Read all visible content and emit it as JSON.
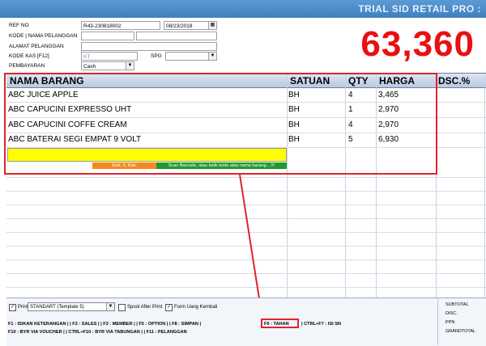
{
  "window": {
    "title": "TRIAL SID RETAIL PRO :"
  },
  "form": {
    "ref_no_label": "REF NO",
    "ref_no_value": "R43-230818002",
    "date_value": "08/23/2018",
    "kode_pelanggan_label": "KODE | NAMA PELANGGAN",
    "alamat_label": "ALAMAT PELANGGAN",
    "kode_kas_label": "KODE KAS [F12]",
    "kode_kas_value": "KT",
    "spg_label": "SPG",
    "pembayaran_label": "PEMBAYARAN",
    "pembayaran_value": "Cash"
  },
  "total_display": "63,360",
  "grid": {
    "headers": [
      "NAMA BARANG",
      "SATUAN",
      "QTY",
      "HARGA",
      "DSC.%"
    ],
    "rows": [
      {
        "nama": "ABC JUICE APPLE",
        "satuan": "BH",
        "qty": "4",
        "harga": "3,465"
      },
      {
        "nama": "ABC CAPUCINI EXPRESSO UHT",
        "satuan": "BH",
        "qty": "1",
        "harga": "2,970"
      },
      {
        "nama": "ABC CAPUCINI COFFE CREAM",
        "satuan": "BH",
        "qty": "4",
        "harga": "2,970"
      },
      {
        "nama": "ABC BATERAI SEGI EMPAT 9 VOLT",
        "satuan": "BH",
        "qty": "5",
        "harga": "6,930"
      }
    ],
    "stok_text": "Stok: 0, Rak:",
    "scan_text": "Scan Barcode, atau ketik kode atau nama barang....!!!"
  },
  "bottom": {
    "print_label": "Print",
    "template_value": "STANDART (Template 5)",
    "spool_label": "Spool After Print",
    "form_uang_label": "Form Uang Kembali",
    "keys_line1_a": "F1 : ISIKAN KETERANGAN | | F2 : SALES | | F3 : MEMBER | | F5 : OPTION | | F8 : SIMPAN |",
    "keys_f9": "F9 : TAHAN",
    "keys_line1_b": "| CTRL+F7 : ISI SN",
    "keys_line2": "F10 : BYR VIA VOUCHER | | CTRL+F10 : BYR VIA TABUNGAN | | F11 : PELANGGAN",
    "summary": [
      "SUBTOTAL",
      "DISC.",
      "PPN",
      "GRANDTOTAL"
    ]
  },
  "colors": {
    "total_red": "#e81010",
    "input_yellow": "#ffff00",
    "stok_orange": "#f28a1f",
    "scan_green": "#1e9a2e",
    "highlight_red": "#e0242c"
  }
}
